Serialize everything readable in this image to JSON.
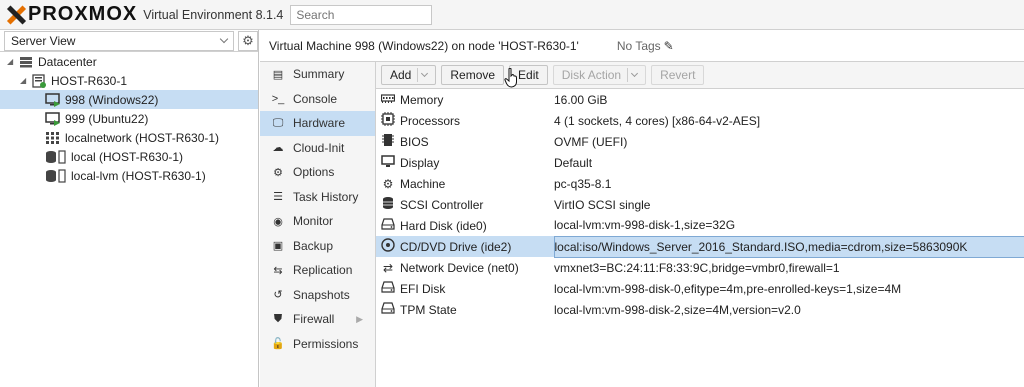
{
  "header": {
    "logo_text": "PROXMOX",
    "product": "Virtual Environment 8.1.4",
    "search_placeholder": "Search"
  },
  "tree": {
    "view_label": "Server View",
    "items": [
      {
        "label": "Datacenter",
        "icon": "datacenter-icon"
      },
      {
        "label": "HOST-R630-1",
        "icon": "server-icon"
      },
      {
        "label": "998 (Windows22)",
        "icon": "vm-running-icon",
        "selected": true
      },
      {
        "label": "999 (Ubuntu22)",
        "icon": "vm-running-icon"
      },
      {
        "label": "localnetwork (HOST-R630-1)",
        "icon": "network-grid-icon"
      },
      {
        "label": "local (HOST-R630-1)",
        "icon": "storage-icon"
      },
      {
        "label": "local-lvm (HOST-R630-1)",
        "icon": "storage-icon"
      }
    ]
  },
  "vm_header": {
    "title": "Virtual Machine 998 (Windows22) on node 'HOST-R630-1'",
    "tags": "No Tags"
  },
  "nav": [
    {
      "label": "Summary",
      "icon": "summary-icon"
    },
    {
      "label": "Console",
      "icon": "terminal-icon"
    },
    {
      "label": "Hardware",
      "icon": "monitor-icon",
      "active": true
    },
    {
      "label": "Cloud-Init",
      "icon": "cloud-icon"
    },
    {
      "label": "Options",
      "icon": "gear-icon"
    },
    {
      "label": "Task History",
      "icon": "list-icon"
    },
    {
      "label": "Monitor",
      "icon": "eye-icon"
    },
    {
      "label": "Backup",
      "icon": "floppy-icon"
    },
    {
      "label": "Replication",
      "icon": "retweet-icon"
    },
    {
      "label": "Snapshots",
      "icon": "history-icon"
    },
    {
      "label": "Firewall",
      "icon": "shield-icon"
    },
    {
      "label": "Permissions",
      "icon": "unlock-icon"
    }
  ],
  "toolbar": {
    "add": "Add",
    "remove": "Remove",
    "edit": "Edit",
    "disk_action": "Disk Action",
    "revert": "Revert"
  },
  "hardware": [
    {
      "name": "Memory",
      "value": "16.00 GiB",
      "icon": "memory-icon"
    },
    {
      "name": "Processors",
      "value": "4 (1 sockets, 4 cores) [x86-64-v2-AES]",
      "icon": "cpu-icon"
    },
    {
      "name": "BIOS",
      "value": "OVMF (UEFI)",
      "icon": "microchip-icon"
    },
    {
      "name": "Display",
      "value": "Default",
      "icon": "desktop-icon"
    },
    {
      "name": "Machine",
      "value": "pc-q35-8.1",
      "icon": "cogs-icon"
    },
    {
      "name": "SCSI Controller",
      "value": "VirtIO SCSI single",
      "icon": "database-icon"
    },
    {
      "name": "Hard Disk (ide0)",
      "value": "local-lvm:vm-998-disk-1,size=32G",
      "icon": "hdd-icon"
    },
    {
      "name": "CD/DVD Drive (ide2)",
      "value": "local:iso/Windows_Server_2016_Standard.ISO,media=cdrom,size=5863090K",
      "icon": "cdrom-icon",
      "selected": true
    },
    {
      "name": "Network Device (net0)",
      "value": "vmxnet3=BC:24:11:F8:33:9C,bridge=vmbr0,firewall=1",
      "icon": "exchange-icon"
    },
    {
      "name": "EFI Disk",
      "value": "local-lvm:vm-998-disk-0,efitype=4m,pre-enrolled-keys=1,size=4M",
      "icon": "hdd-icon"
    },
    {
      "name": "TPM State",
      "value": "local-lvm:vm-998-disk-2,size=4M,version=v2.0",
      "icon": "hdd-icon"
    }
  ]
}
